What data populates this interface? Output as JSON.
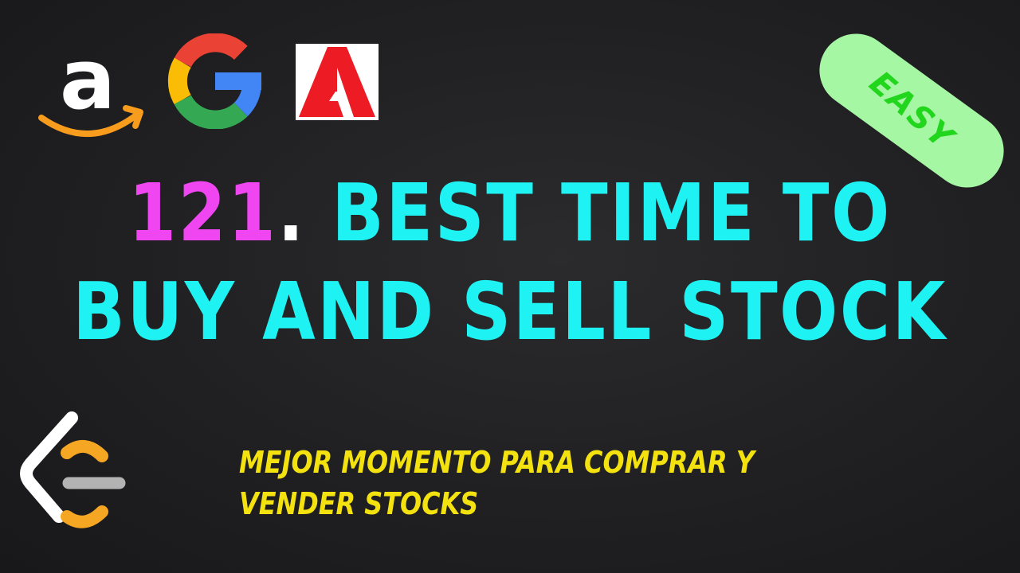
{
  "badge": {
    "label": "EASY"
  },
  "title": {
    "number": "121",
    "dot": ".",
    "line1": " BEST TIME TO",
    "line2": "BUY AND SELL STOCK"
  },
  "subtitle": {
    "line1": "MEJOR MOMENTO PARA COMPRAR Y",
    "line2": "VENDER STOCKS"
  },
  "colors": {
    "background": "#202022",
    "title": "#1ff2f2",
    "number": "#f046f2",
    "subtitle": "#f3e20f",
    "badge_fill": "#a6f7a4",
    "badge_text": "#22d61e"
  },
  "icons": [
    "amazon-logo",
    "google-logo",
    "adobe-logo",
    "leetcode-logo"
  ]
}
